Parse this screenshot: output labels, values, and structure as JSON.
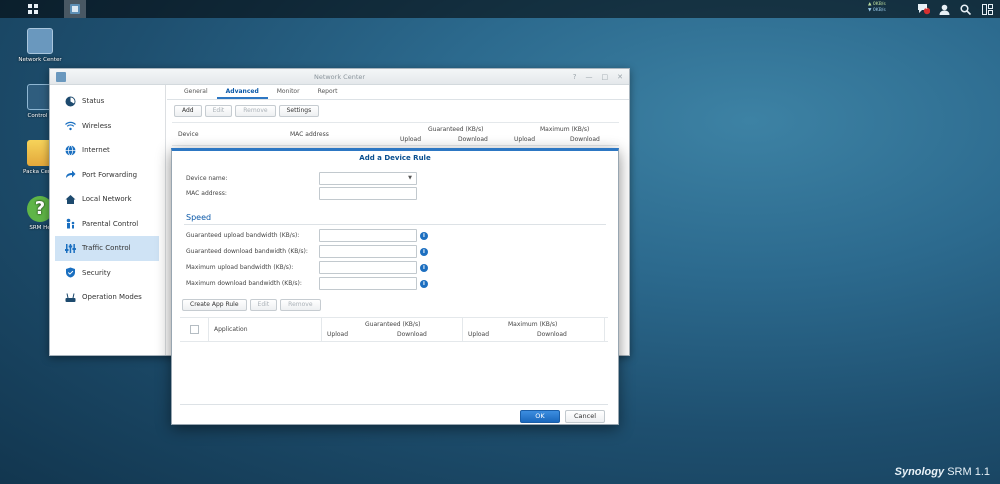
{
  "taskbar": {
    "speed_up": "0KB/s",
    "speed_down": "0KB/s",
    "notification_count": "1"
  },
  "desktop": {
    "icons": [
      "Network Center",
      "Control P",
      "Packa Cente",
      "SRM He"
    ],
    "brand_name": "Synology",
    "brand_product": "SRM",
    "brand_version": "1.1"
  },
  "window": {
    "title": "Network Center",
    "sidebar": [
      {
        "label": "Status",
        "icon": "status-icon",
        "color": "#1d4a6e"
      },
      {
        "label": "Wireless",
        "icon": "wifi-icon",
        "color": "#1a6fc0"
      },
      {
        "label": "Internet",
        "icon": "globe-icon",
        "color": "#1a6fc0"
      },
      {
        "label": "Port Forwarding",
        "icon": "arrow-icon",
        "color": "#1a6fc0"
      },
      {
        "label": "Local Network",
        "icon": "house-icon",
        "color": "#1d4a6e"
      },
      {
        "label": "Parental Control",
        "icon": "family-icon",
        "color": "#1a6fc0"
      },
      {
        "label": "Traffic Control",
        "icon": "sliders-icon",
        "color": "#1a6fc0"
      },
      {
        "label": "Security",
        "icon": "shield-icon",
        "color": "#1a6fc0"
      },
      {
        "label": "Operation Modes",
        "icon": "router-icon",
        "color": "#1d4a6e"
      }
    ],
    "tabs": [
      "General",
      "Advanced",
      "Monitor",
      "Report"
    ],
    "toolbar": {
      "add": "Add",
      "edit": "Edit",
      "remove": "Remove",
      "settings": "Settings"
    },
    "table": {
      "device": "Device",
      "mac": "MAC address",
      "guaranteed": "Guaranteed (KB/s)",
      "maximum": "Maximum (KB/s)",
      "upload": "Upload",
      "download": "Download"
    }
  },
  "dialog": {
    "title": "Add a Device Rule",
    "device_name_label": "Device name:",
    "mac_label": "MAC address:",
    "speed_title": "Speed",
    "speed_fields": [
      "Guaranteed upload bandwidth (KB/s):",
      "Guaranteed download bandwidth (KB/s):",
      "Maximum upload bandwidth (KB/s):",
      "Maximum download bandwidth (KB/s):"
    ],
    "app_toolbar": {
      "create": "Create App Rule",
      "edit": "Edit",
      "remove": "Remove"
    },
    "app_table": {
      "application": "Application",
      "guaranteed": "Guaranteed (KB/s)",
      "maximum": "Maximum (KB/s)",
      "upload": "Upload",
      "download": "Download"
    },
    "ok": "OK",
    "cancel": "Cancel"
  }
}
